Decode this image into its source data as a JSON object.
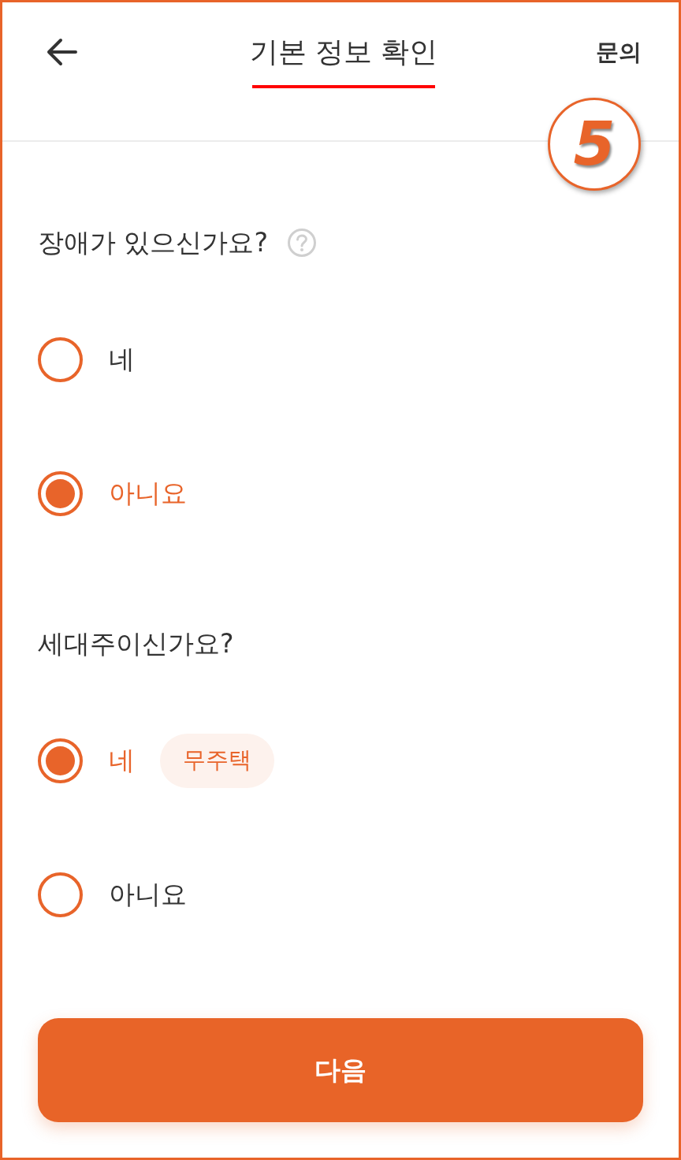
{
  "header": {
    "title": "기본 정보 확인",
    "title_underlined": true,
    "action": "문의"
  },
  "step_marker": "5",
  "questions": [
    {
      "text": "장애가 있으신가요?",
      "help": true,
      "options": [
        {
          "label": "네",
          "selected": false
        },
        {
          "label": "아니요",
          "selected": true
        }
      ]
    },
    {
      "text": "세대주이신가요?",
      "help": false,
      "options": [
        {
          "label": "네",
          "selected": true,
          "badge": "무주택"
        },
        {
          "label": "아니요",
          "selected": false
        }
      ]
    }
  ],
  "next_button": "다음"
}
